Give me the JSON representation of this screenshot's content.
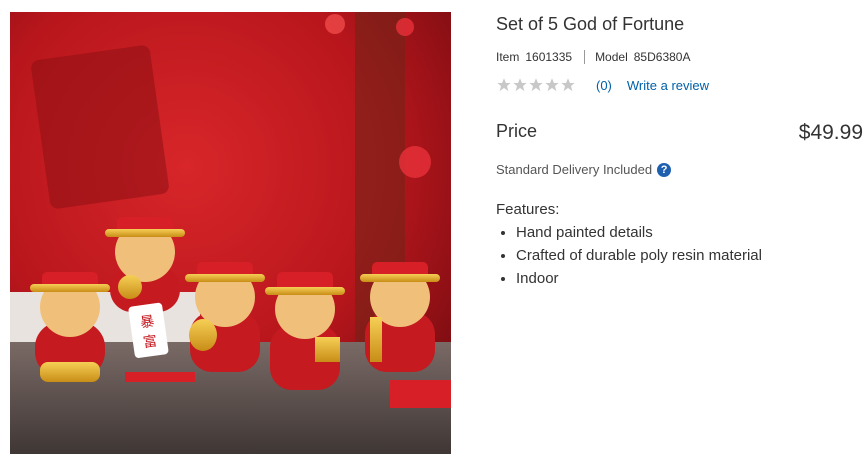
{
  "product": {
    "image_alt": "Set of 5 God of Fortune figurines",
    "title": "Set of 5 God of Fortune",
    "item_label": "Item",
    "item_number": "1601335",
    "model_label": "Model",
    "model_number": "85D6380A",
    "rating": {
      "stars": 0,
      "max_stars": 5,
      "count": "(0)",
      "review_link": "Write a review"
    },
    "price_label": "Price",
    "price": "$49.99",
    "delivery_text": "Standard Delivery Included",
    "delivery_icon": "question-circle-icon",
    "features_label": "Features:",
    "features": [
      "Hand painted details",
      "Crafted of durable poly resin material",
      "Indoor"
    ],
    "tag_text": [
      "暴",
      "富"
    ]
  },
  "colors": {
    "link": "#0060a9",
    "star_empty": "#c8c8c8",
    "help_icon": "#1f5fb0"
  }
}
